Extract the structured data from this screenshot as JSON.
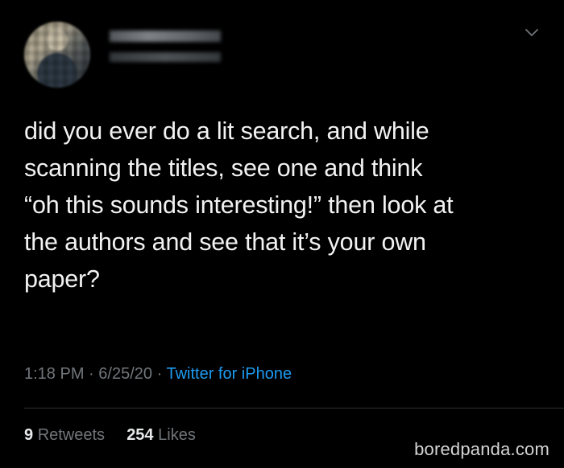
{
  "tweet": {
    "text": "did you ever do a lit search, and while\nscanning the titles, see one and think\n“oh this sounds interesting!” then look at\nthe authors and see that it’s your own\npaper?",
    "time": "1:18 PM",
    "date": "6/25/20",
    "separator": "·",
    "source": "Twitter for iPhone"
  },
  "stats": {
    "retweets_count": "9",
    "retweets_label": "Retweets",
    "likes_count": "254",
    "likes_label": "Likes"
  },
  "watermark": "boredpanda.com",
  "colors": {
    "background": "#000000",
    "text": "#f2f2f2",
    "muted": "#71767b",
    "link": "#1d9bf0",
    "divider": "#2f3336"
  },
  "icons": {
    "menu": "chevron-down-icon"
  }
}
